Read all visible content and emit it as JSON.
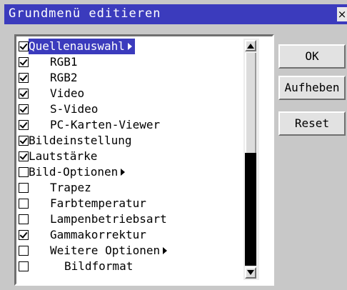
{
  "dialog": {
    "title": "Grundmenü editieren",
    "close_label": "×"
  },
  "list": {
    "items": [
      {
        "label": "Quellenauswahl",
        "checked": true,
        "indent": 0,
        "submenu": true,
        "selected": true
      },
      {
        "label": "RGB1",
        "checked": true,
        "indent": 1,
        "submenu": false,
        "selected": false
      },
      {
        "label": "RGB2",
        "checked": true,
        "indent": 1,
        "submenu": false,
        "selected": false
      },
      {
        "label": "Video",
        "checked": true,
        "indent": 1,
        "submenu": false,
        "selected": false
      },
      {
        "label": "S-Video",
        "checked": true,
        "indent": 1,
        "submenu": false,
        "selected": false
      },
      {
        "label": "PC-Karten-Viewer",
        "checked": true,
        "indent": 1,
        "submenu": false,
        "selected": false
      },
      {
        "label": "Bildeinstellung",
        "checked": true,
        "indent": 0,
        "submenu": false,
        "selected": false
      },
      {
        "label": "Lautstärke",
        "checked": true,
        "indent": 0,
        "submenu": false,
        "selected": false
      },
      {
        "label": "Bild-Optionen",
        "checked": false,
        "indent": 0,
        "submenu": true,
        "selected": false
      },
      {
        "label": "Trapez",
        "checked": false,
        "indent": 1,
        "submenu": false,
        "selected": false
      },
      {
        "label": "Farbtemperatur",
        "checked": false,
        "indent": 1,
        "submenu": false,
        "selected": false
      },
      {
        "label": "Lampenbetriebsart",
        "checked": false,
        "indent": 1,
        "submenu": false,
        "selected": false
      },
      {
        "label": "Gammakorrektur",
        "checked": true,
        "indent": 1,
        "submenu": false,
        "selected": false
      },
      {
        "label": "Weitere Optionen",
        "checked": false,
        "indent": 1,
        "submenu": true,
        "selected": false
      },
      {
        "label": "Bildformat",
        "checked": false,
        "indent": 2,
        "submenu": false,
        "selected": false
      }
    ]
  },
  "buttons": {
    "ok": "OK",
    "cancel": "Aufheben",
    "reset": "Reset"
  },
  "colors": {
    "title_bar": "#3b3bbd",
    "selection": "#3b3bbd",
    "background": "#c8c8c8"
  }
}
